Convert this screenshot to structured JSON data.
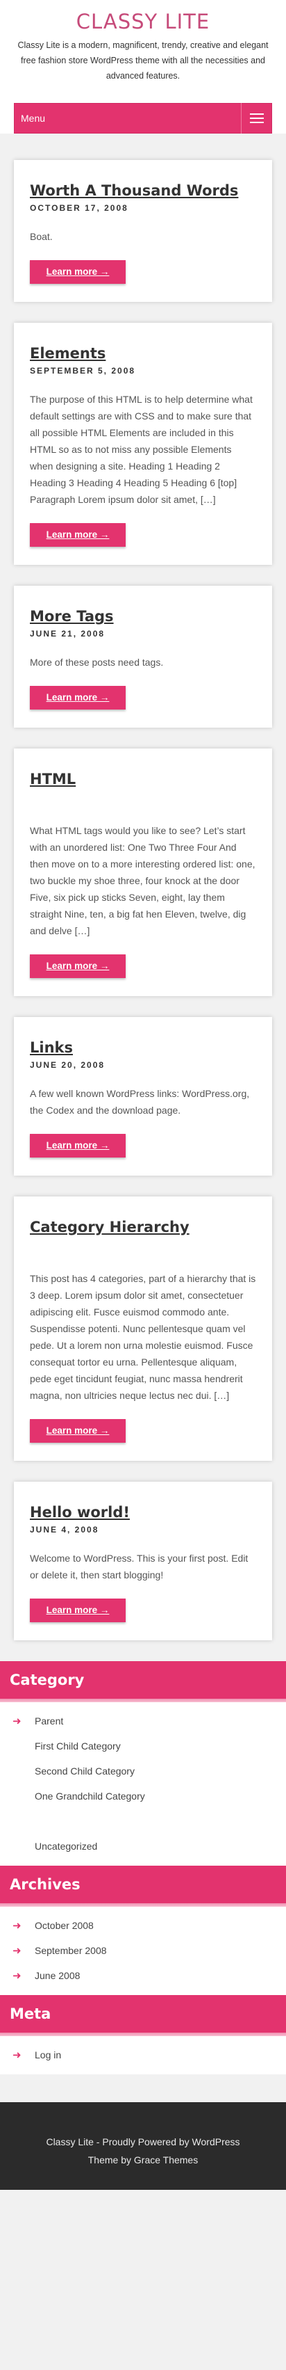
{
  "site": {
    "title": "CLASSY LITE",
    "description": "Classy Lite is a modern, magnificent, trendy, creative and elegant free fashion store WordPress theme with all the necessities and advanced features."
  },
  "menu": {
    "label": "Menu"
  },
  "colors": {
    "accent": "#e3336e",
    "title": "#c64b7a",
    "footer": "#2b2b2b"
  },
  "posts": [
    {
      "title": "Worth A Thousand Words",
      "date": "OCTOBER 17, 2008",
      "excerpt": "Boat.",
      "read_more": "Learn more →"
    },
    {
      "title": "Elements",
      "date": "SEPTEMBER 5, 2008",
      "excerpt": "The purpose of this HTML is to help determine what default settings are with CSS and to make sure that all possible HTML Elements are included in this HTML so as to not miss any possible Elements when designing a site. Heading 1 Heading 2 Heading 3 Heading 4 Heading 5 Heading 6 [top] Paragraph Lorem ipsum dolor sit amet, […]",
      "read_more": "Learn more →"
    },
    {
      "title": "More Tags",
      "date": "JUNE 21, 2008",
      "excerpt": "More of these posts need tags.",
      "read_more": "Learn more →"
    },
    {
      "title": "HTML",
      "date": "",
      "excerpt": "What HTML tags would you like to see? Let’s start with an unordered list: One Two Three Four And then move on to a more interesting ordered list: one, two buckle my shoe three, four knock at the door Five, six pick up sticks Seven, eight, lay them straight Nine, ten, a big fat hen Eleven, twelve, dig and delve […]",
      "read_more": "Learn more →"
    },
    {
      "title": "Links",
      "date": "JUNE 20, 2008",
      "excerpt": "A few well known WordPress links: WordPress.org, the Codex and the download page.",
      "read_more": "Learn more →"
    },
    {
      "title": "Category Hierarchy",
      "date": "",
      "excerpt": "This post has 4 categories, part of a hierarchy that is 3 deep. Lorem ipsum dolor sit amet, consectetuer adipiscing elit. Fusce euismod commodo ante. Suspendisse potenti. Nunc pellentesque quam vel pede. Ut a lorem non urna molestie euismod. Fusce consequat tortor eu urna. Pellentesque aliquam, pede eget tincidunt feugiat, nunc massa hendrerit magna, non ultricies neque lectus nec dui. […]",
      "read_more": "Learn more →"
    },
    {
      "title": "Hello world!",
      "date": "JUNE 4, 2008",
      "excerpt": "Welcome to WordPress. This is your first post. Edit or delete it, then start blogging!",
      "read_more": "Learn more →"
    }
  ],
  "widgets": {
    "category": {
      "title": "Category",
      "items": [
        "Parent",
        "First Child Category",
        "Second Child Category",
        "One Grandchild Category",
        "Uncategorized"
      ]
    },
    "archives": {
      "title": "Archives",
      "items": [
        "October 2008",
        "September 2008",
        "June 2008"
      ]
    },
    "meta": {
      "title": "Meta",
      "items": [
        "Log in"
      ]
    }
  },
  "footer": {
    "line1": "Classy Lite - Proudly Powered by WordPress",
    "line2": "Theme by Grace Themes"
  }
}
